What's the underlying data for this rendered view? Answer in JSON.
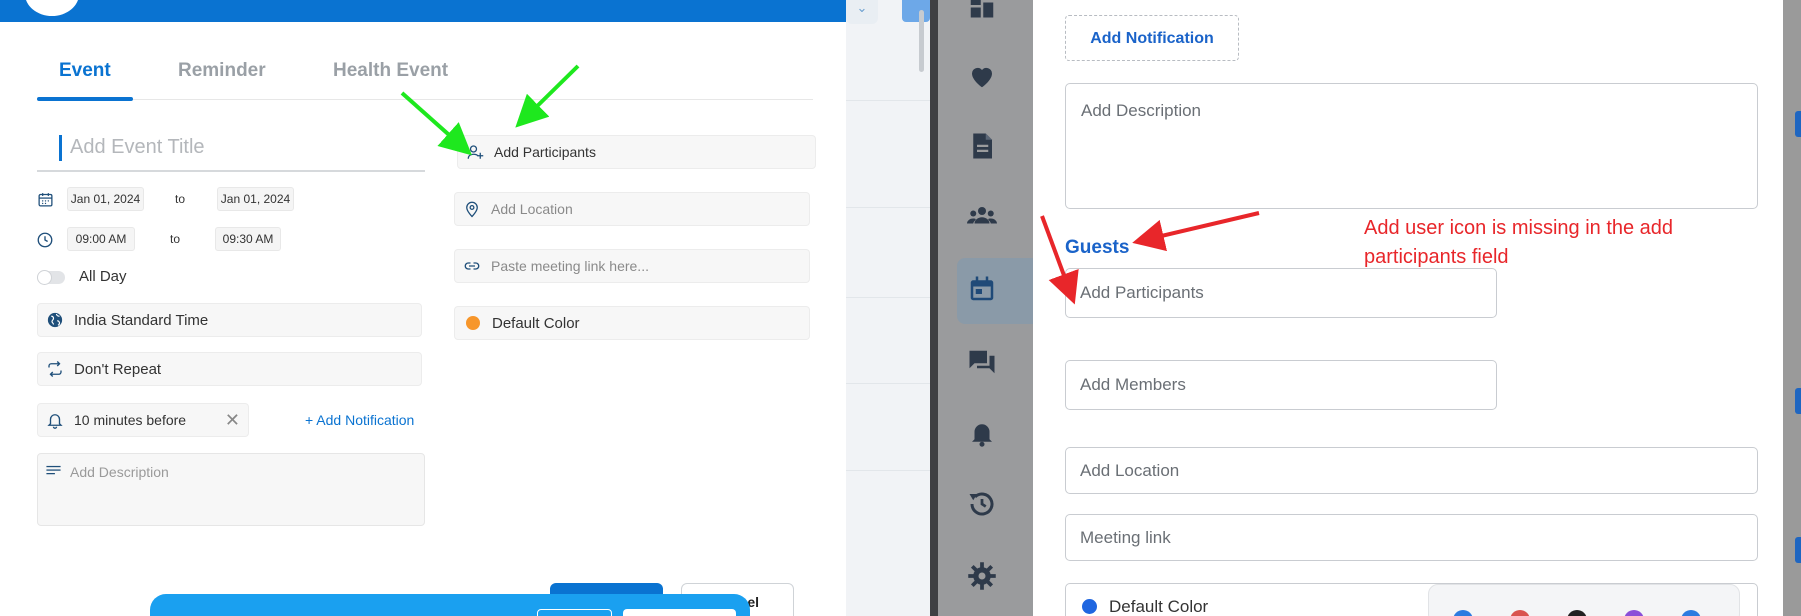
{
  "left_panel": {
    "tabs": [
      {
        "label": "Event",
        "active": true
      },
      {
        "label": "Reminder",
        "active": false
      },
      {
        "label": "Health Event",
        "active": false
      }
    ],
    "title_placeholder": "Add Event Title",
    "date_from": "Jan 01, 2024",
    "date_to": "Jan 01, 2024",
    "to_label": "to",
    "time_from": "09:00 AM",
    "time_to": "09:30 AM",
    "all_day": "All Day",
    "timezone": "India Standard Time",
    "repeat": "Don't Repeat",
    "notification": "10 minutes before",
    "add_notification": "+ Add Notification",
    "description_placeholder": "Add Description",
    "participants_placeholder": "Add Participants",
    "location_placeholder": "Add Location",
    "meeting_link_placeholder": "Paste meeting link here...",
    "color_label": "Default Color",
    "cancel_fragment": "el"
  },
  "right_panel": {
    "add_notification": "Add Notification",
    "description_placeholder": "Add Description",
    "guests_label": "Guests",
    "participants_placeholder": "Add Participants",
    "members_placeholder": "Add Members",
    "location_placeholder": "Add Location",
    "meeting_link_placeholder": "Meeting link",
    "color_label": "Default Color",
    "annotation": "Add user icon is missing in the add participants field"
  },
  "colors": {
    "brand_blue": "#0a73d1",
    "link_blue": "#1a63c9",
    "annotation_red": "#e8262a",
    "arrow_green": "#1ee81e",
    "orange_dot": "#f7962b",
    "blue_dot": "#1f66e0"
  },
  "icons": {
    "sidebar": [
      "dashboard-icon",
      "heart-icon",
      "document-icon",
      "group-icon",
      "calendar-icon",
      "chat-icon",
      "bell-icon",
      "history-icon",
      "gear-icon"
    ]
  }
}
